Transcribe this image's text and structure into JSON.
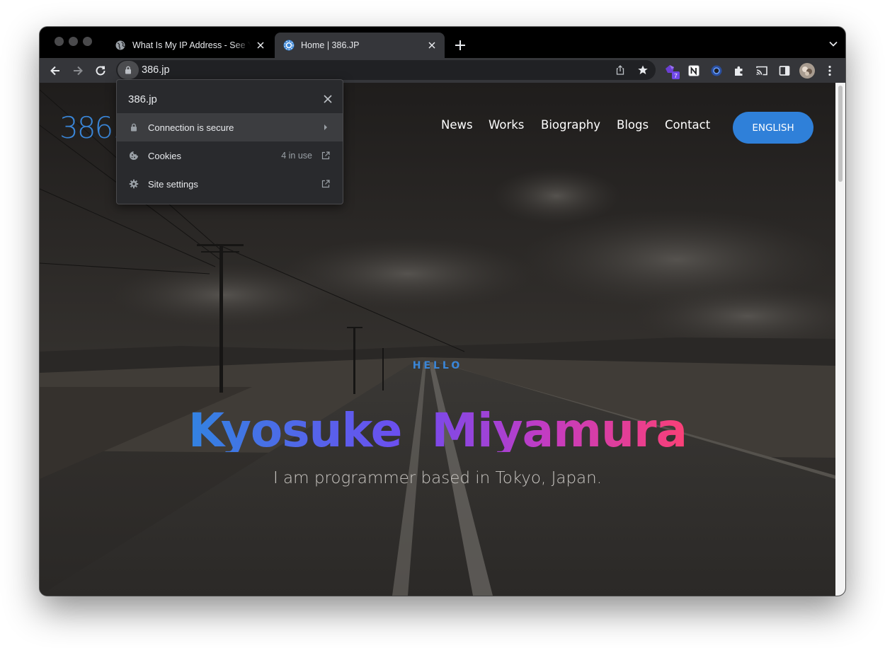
{
  "browser": {
    "tabs": [
      {
        "title": "What Is My IP Address - See Your Public Address",
        "favicon": "globe-icon",
        "active": false
      },
      {
        "title": "Home | 386.JP",
        "favicon": "site-favicon",
        "active": true
      }
    ],
    "address_bar": {
      "url": "386.jp"
    },
    "extension_badge": "7"
  },
  "site_info_popup": {
    "domain": "386.jp",
    "items": [
      {
        "label": "Connection is secure",
        "icon": "lock-icon",
        "trailing": "chevron-right-icon"
      },
      {
        "label": "Cookies",
        "icon": "cookie-icon",
        "meta": "4 in use",
        "trailing": "open-external-icon"
      },
      {
        "label": "Site settings",
        "icon": "gear-icon",
        "trailing": "open-external-icon"
      }
    ]
  },
  "page": {
    "logo_text": "386..",
    "nav": [
      "News",
      "Works",
      "Biography",
      "Blogs",
      "Contact"
    ],
    "language_button": "ENGLISH",
    "greeting": "HELLO",
    "name_first": "Kyosuke",
    "name_last": "Miyamura",
    "tagline": "I am programmer based in Tokyo, Japan."
  },
  "colors": {
    "accent_blue": "#2f80d9",
    "gradient": [
      "#2f86e0",
      "#6f4cf0",
      "#c13cc4",
      "#ff4070"
    ],
    "popup_bg": "#292a2d",
    "toolbar_bg": "#35363a"
  }
}
